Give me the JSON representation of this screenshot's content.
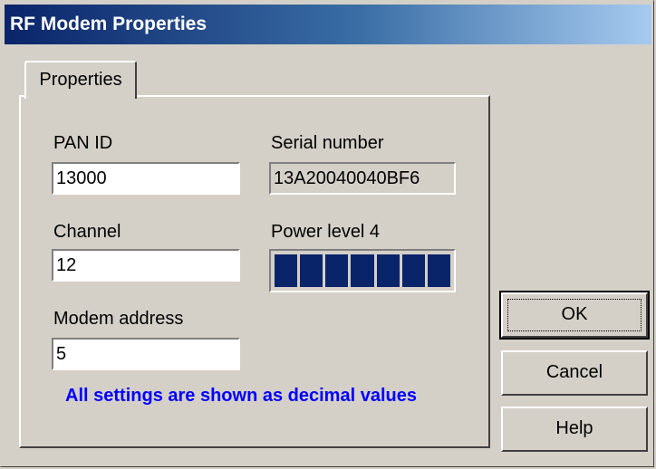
{
  "window": {
    "title": "RF Modem Properties"
  },
  "tabs": [
    {
      "label": "Properties"
    }
  ],
  "fields": {
    "pan_id": {
      "label": "PAN ID",
      "value": "13000"
    },
    "serial_number": {
      "label": "Serial number",
      "value": "13A20040040BF6"
    },
    "channel": {
      "label": "Channel",
      "value": "12"
    },
    "power_level": {
      "label": "Power level 4",
      "segments": 7,
      "segment_color": "#0a246a"
    },
    "modem_address": {
      "label": "Modem address",
      "value": "5"
    }
  },
  "note": "All settings are shown as decimal values",
  "buttons": {
    "ok": "OK",
    "cancel": "Cancel",
    "help": "Help"
  },
  "colors": {
    "title_bar_start": "#0a246a",
    "title_bar_end": "#a6caf0",
    "note_text": "#0000ff",
    "dialog_face": "#d4d0c8"
  }
}
